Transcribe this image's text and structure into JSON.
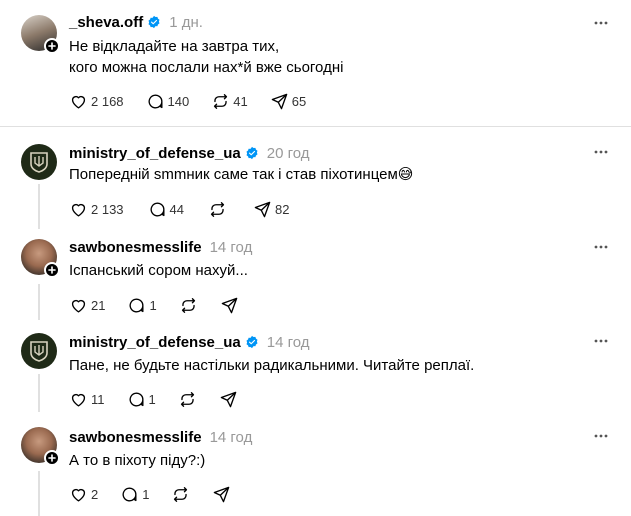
{
  "posts": [
    {
      "username": "_sheva.off",
      "time": "1 дн.",
      "text": "Не відкладайте на завтра тих,\nкого можна послали нах*й вже сьогодні",
      "likes": "2 168",
      "comments": "140",
      "reposts": "41",
      "shares": "65"
    },
    {
      "username": "ministry_of_defense_ua",
      "time": "20 год",
      "text": "Попередній smmник саме так і став піхотинцем",
      "emoji": "😅",
      "likes": "2 133",
      "comments": "44",
      "reposts": "",
      "shares": "82"
    },
    {
      "username": "sawbonesmesslife",
      "time": "14 год",
      "text": "Іспанський сором нахуй...",
      "likes": "21",
      "comments": "1",
      "reposts": "",
      "shares": ""
    },
    {
      "username": "ministry_of_defense_ua",
      "time": "14 год",
      "text": "Пане, не будьте настільки радикальними. Читайте реплаї.",
      "likes": "11",
      "comments": "1",
      "reposts": "",
      "shares": ""
    },
    {
      "username": "sawbonesmesslife",
      "time": "14 год",
      "text": "А то в піхоту піду?:)",
      "likes": "2",
      "comments": "1",
      "reposts": "",
      "shares": ""
    }
  ],
  "icons": {
    "verified": "verified-badge-icon",
    "more": "more-horizontal-icon",
    "like": "heart-icon",
    "comment": "comment-icon",
    "repost": "repost-icon",
    "share": "send-icon",
    "follow": "plus-icon"
  },
  "colors": {
    "verified": "#0095f6",
    "muted": "#999999",
    "divider": "#e0e0e0"
  }
}
